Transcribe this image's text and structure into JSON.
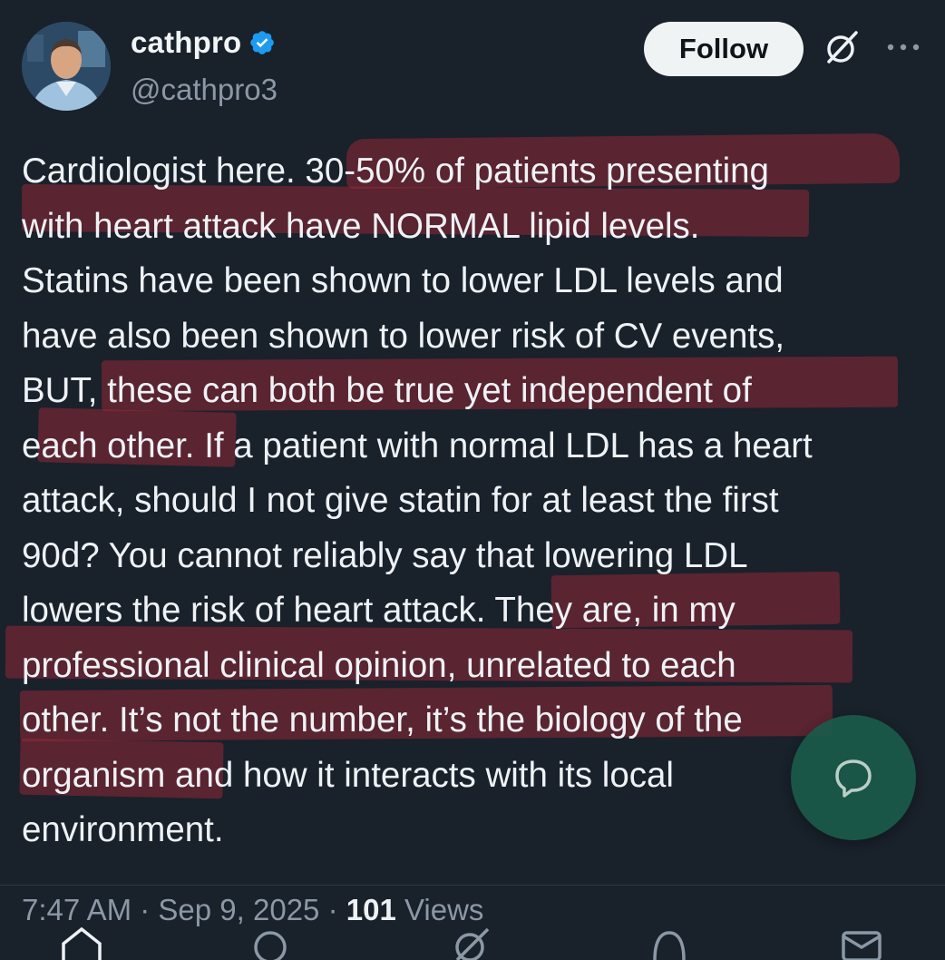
{
  "author": {
    "display_name": "cathpro",
    "handle": "@cathpro3",
    "verified": true
  },
  "actions": {
    "follow_label": "Follow"
  },
  "icons": [
    "verified-badge-icon",
    "grok-icon",
    "more-icon",
    "reply-icon",
    "home-icon",
    "search-icon",
    "grok-icon",
    "notifications-icon",
    "messages-icon"
  ],
  "tweet": {
    "lines": [
      "Cardiologist here. 30-50% of patients presenting",
      "with heart attack have NORMAL lipid levels.",
      "Statins have been shown to lower LDL levels and",
      "have also been shown to lower risk of CV events,",
      "BUT, these can both be true yet independent of",
      "each other. If a patient with normal LDL has a heart",
      "attack, should I not give statin for at least the first",
      "90d? You cannot reliably say that lowering LDL",
      "lowers the risk of heart attack. They are, in my",
      "professional clinical opinion, unrelated to each",
      "other. It’s not the number, it’s the biology of the",
      "organism and how it interacts with its local",
      "environment."
    ]
  },
  "meta": {
    "time": "7:47 AM",
    "separator": " · ",
    "date": "Sep 9, 2025",
    "views_count": "101",
    "views_label": " Views"
  },
  "colors": {
    "background": "#19212b",
    "highlight": "#96283a",
    "verified": "#1d9bf0",
    "fab": "#1a5b4a",
    "secondary_text": "#8b98a5"
  }
}
